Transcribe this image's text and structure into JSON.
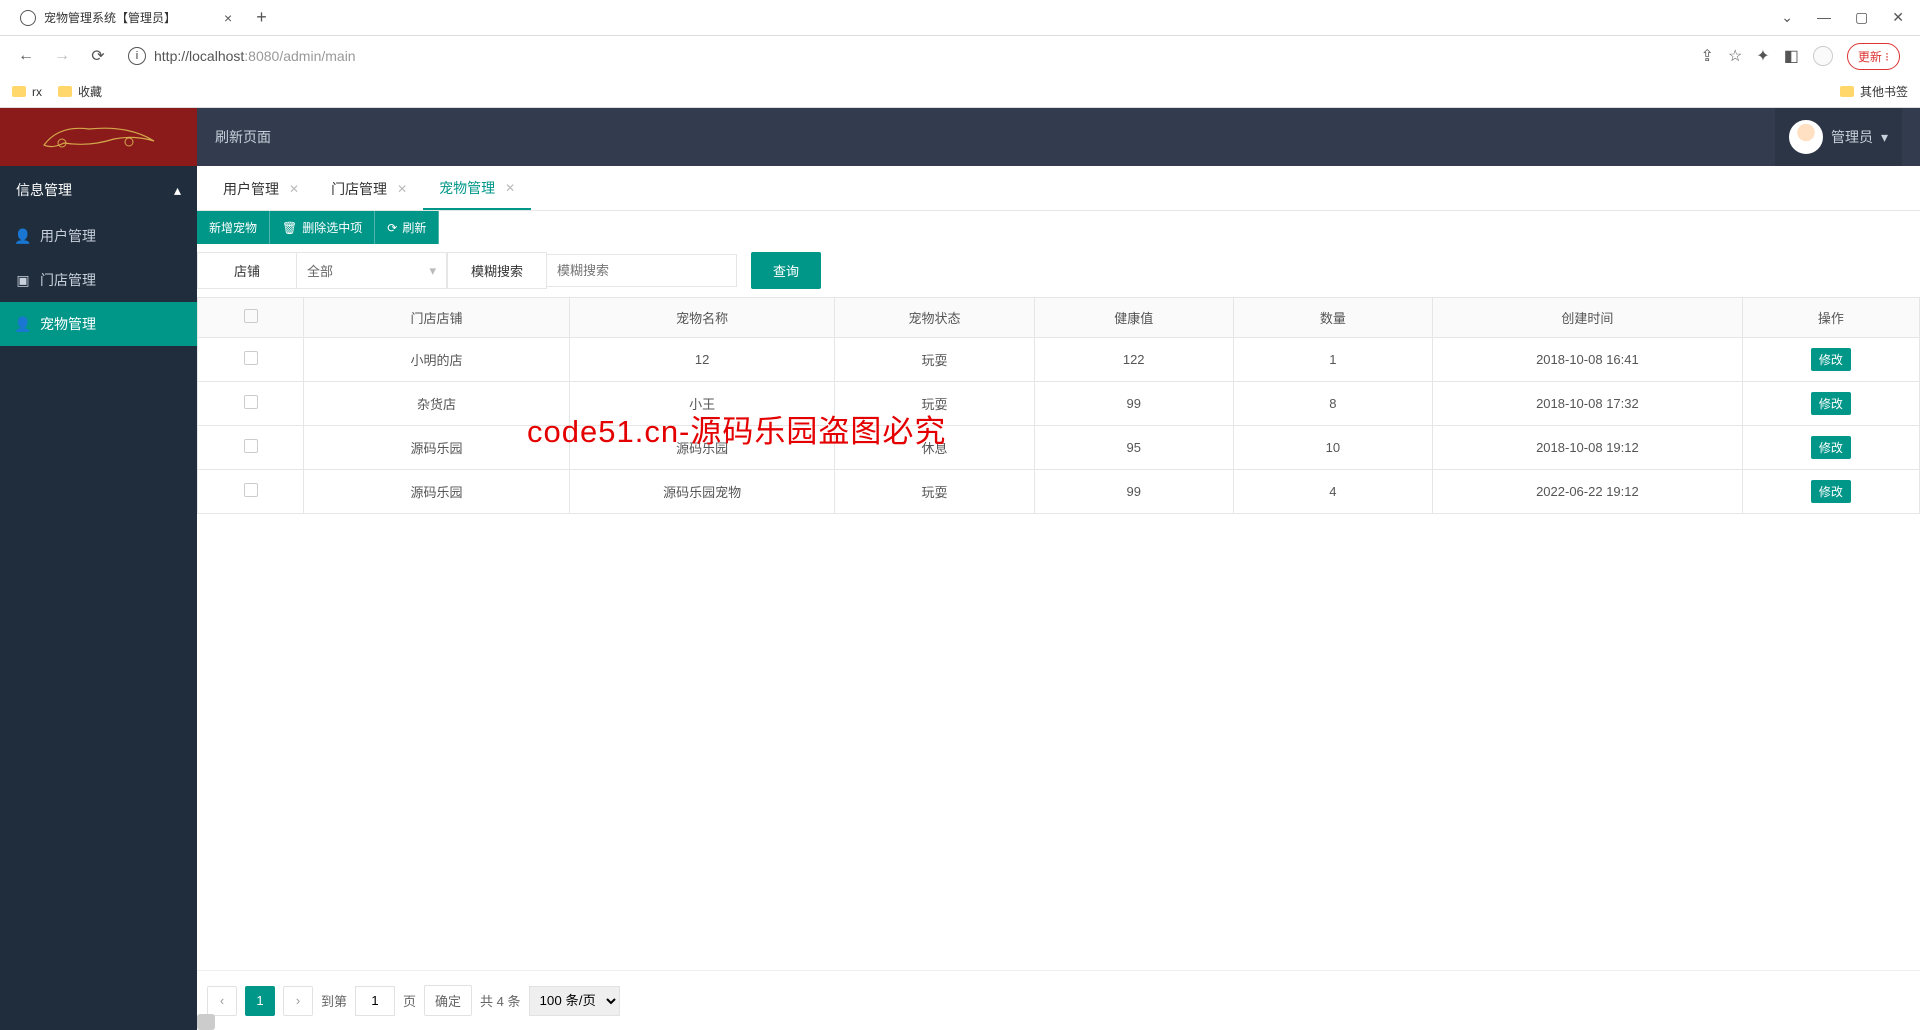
{
  "browser": {
    "tab_title": "宠物管理系统【管理员】",
    "url_prefix": "http://",
    "url_host": "localhost",
    "url_port_path": ":8080/admin/main",
    "update_label": "更新",
    "bookmarks": [
      "rx",
      "收藏"
    ],
    "other_bookmarks": "其他书签"
  },
  "topbar": {
    "refresh_label": "刷新页面",
    "user_label": "管理员"
  },
  "sidebar": {
    "header": "信息管理",
    "items": [
      {
        "label": "用户管理"
      },
      {
        "label": "门店管理"
      },
      {
        "label": "宠物管理"
      }
    ]
  },
  "tabs": [
    {
      "label": "用户管理",
      "active": false
    },
    {
      "label": "门店管理",
      "active": false
    },
    {
      "label": "宠物管理",
      "active": true
    }
  ],
  "toolbar": {
    "add": "新增宠物",
    "delete": "删除选中项",
    "refresh": "刷新"
  },
  "filter": {
    "store_label": "店铺",
    "store_value": "全部",
    "fuzzy_label": "模糊搜索",
    "fuzzy_placeholder": "模糊搜索",
    "query": "查询"
  },
  "table": {
    "headers": [
      "门店店铺",
      "宠物名称",
      "宠物状态",
      "健康值",
      "数量",
      "创建时间",
      "操作"
    ],
    "edit_label": "修改",
    "rows": [
      {
        "store": "小明的店",
        "name": "12",
        "status": "玩耍",
        "health": "122",
        "qty": "1",
        "time": "2018-10-08 16:41"
      },
      {
        "store": "杂货店",
        "name": "小王",
        "status": "玩耍",
        "health": "99",
        "qty": "8",
        "time": "2018-10-08 17:32"
      },
      {
        "store": "源码乐园",
        "name": "源码乐园",
        "status": "休息",
        "health": "95",
        "qty": "10",
        "time": "2018-10-08 19:12"
      },
      {
        "store": "源码乐园",
        "name": "源码乐园宠物",
        "status": "玩耍",
        "health": "99",
        "qty": "4",
        "time": "2022-06-22 19:12"
      }
    ]
  },
  "pager": {
    "page": "1",
    "goto_label": "到第",
    "goto_value": "1",
    "page_suffix": "页",
    "confirm": "确定",
    "total": "共 4 条",
    "per_page": "100 条/页"
  },
  "watermark": "code51.cn-源码乐园盗图必究"
}
